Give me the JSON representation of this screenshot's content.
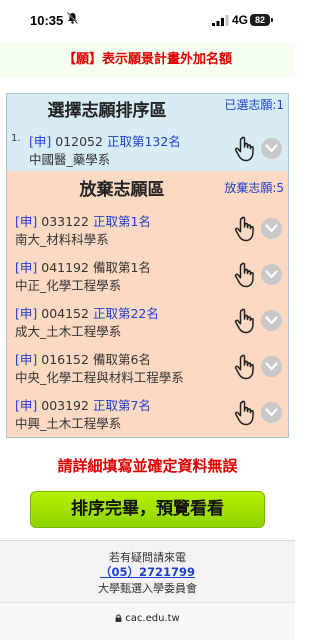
{
  "status_bar": {
    "time": "10:35",
    "network": "4G",
    "battery": "82"
  },
  "notice": "【願】表示願景計畫外加名額",
  "selected": {
    "title": "選擇志願排序區",
    "count_label": "已選志願:1",
    "items": [
      {
        "rank": "1.",
        "tag": "[申]",
        "code": "012052",
        "status": "正取第132名",
        "status_highlight": true,
        "name": "中國醫_藥學系"
      }
    ]
  },
  "abandoned": {
    "title": "放棄志願區",
    "count_label": "放棄志願:5",
    "items": [
      {
        "tag": "[申]",
        "code": "033122",
        "status": "正取第1名",
        "status_highlight": true,
        "name": "南大_材料科學系"
      },
      {
        "tag": "[申]",
        "code": "041192",
        "status": "備取第1名",
        "status_highlight": false,
        "name": "中正_化學工程學系"
      },
      {
        "tag": "[申]",
        "code": "004152",
        "status": "正取第22名",
        "status_highlight": true,
        "name": "成大_土木工程學系"
      },
      {
        "tag": "[申]",
        "code": "016152",
        "status": "備取第6名",
        "status_highlight": false,
        "name": "中央_化學工程與材料工程學系"
      },
      {
        "tag": "[申]",
        "code": "003192",
        "status": "正取第7名",
        "status_highlight": true,
        "name": "中興_土木工程學系"
      }
    ]
  },
  "warning": "請詳細填寫並確定資料無誤",
  "primary_button": "排序完畢，預覽看看",
  "footer": {
    "line1": "若有疑問請來電",
    "phone": "（05）2721799",
    "org": "大學甄選入學委員會"
  },
  "url": "cac.edu.tw",
  "colors": {
    "accent_blue": "#1f3fd0",
    "alert_red": "#e00000",
    "button_green": "#9ae000"
  }
}
